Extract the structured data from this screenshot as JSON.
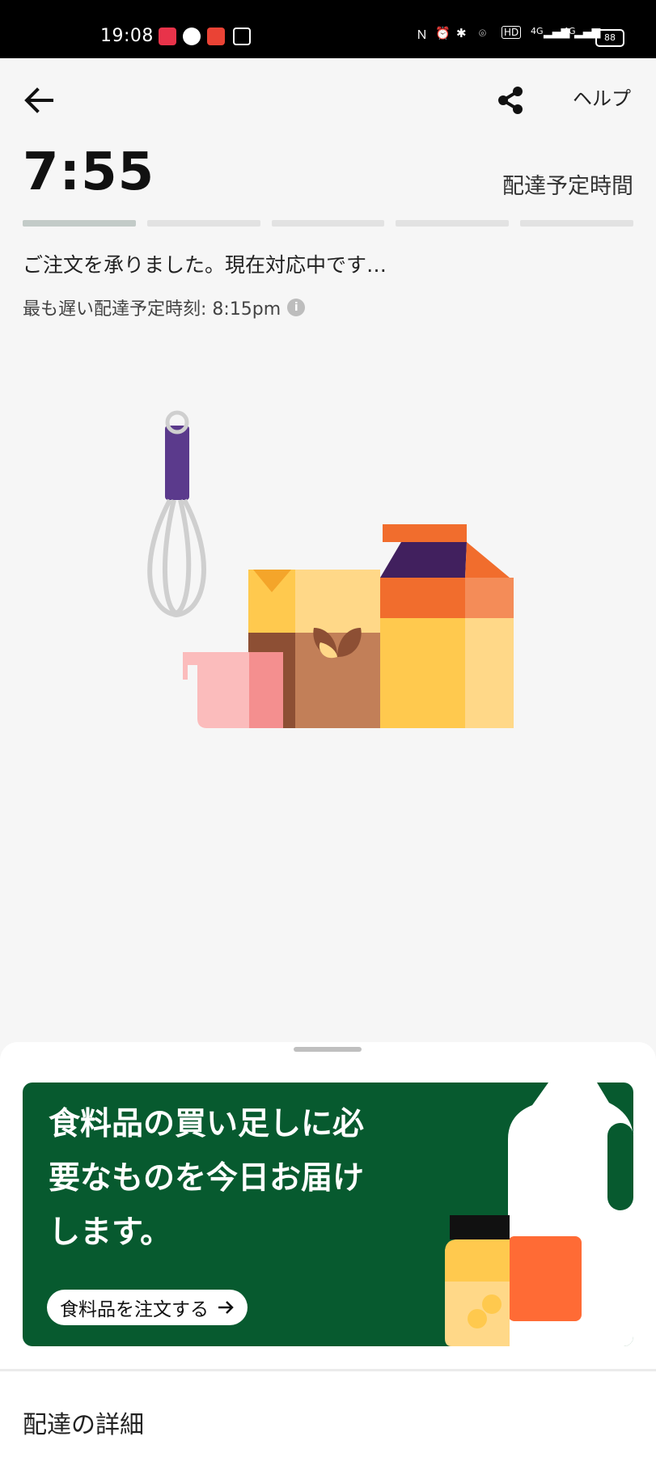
{
  "status_bar": {
    "time": "19:08",
    "network_left": "4G",
    "network_right": "4G",
    "battery": "88"
  },
  "header": {
    "help_label": "ヘルプ"
  },
  "eta": {
    "time": "7:55",
    "label": "配達予定時間",
    "progress_steps": 5,
    "progress_active": 1
  },
  "order_status": {
    "message": "ご注文を承りました。現在対応中です…",
    "latest_time_text": "最も遅い配達予定時刻: 8:15pm"
  },
  "promo": {
    "headline_line1": "食料品の買い足しに必",
    "headline_line2": "要なものを今日お届け",
    "headline_line3": "します。",
    "button_label": "食料品を注文する",
    "bg_color": "#075a2f"
  },
  "details": {
    "title": "配達の詳細"
  }
}
